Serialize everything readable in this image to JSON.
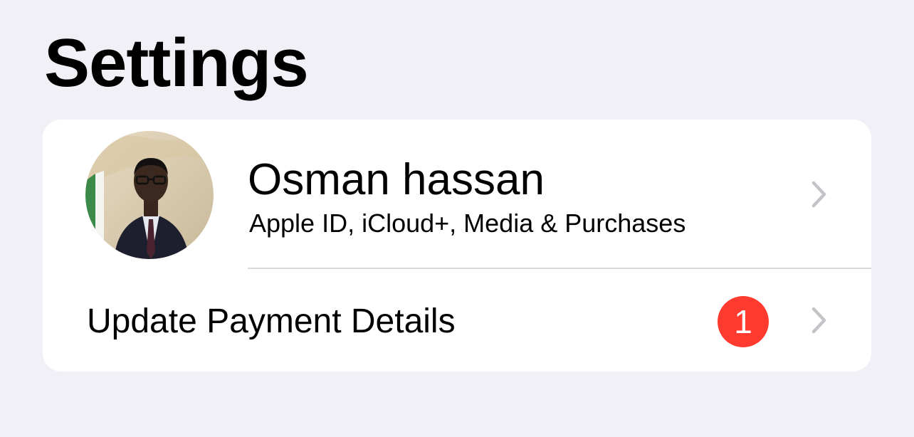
{
  "header": {
    "title": "Settings"
  },
  "profile": {
    "name": "Osman hassan",
    "subtitle": "Apple ID, iCloud+, Media & Purchases",
    "avatar_icon": "profile-photo",
    "chevron_icon": "chevron-right-icon"
  },
  "payment": {
    "label": "Update Payment Details",
    "badge_count": "1",
    "badge_color": "#ff3b30",
    "chevron_icon": "chevron-right-icon"
  },
  "colors": {
    "background": "#f0f0f6",
    "card": "#ffffff",
    "separator": "#d8d8dd",
    "chevron": "#c4c4c8"
  }
}
